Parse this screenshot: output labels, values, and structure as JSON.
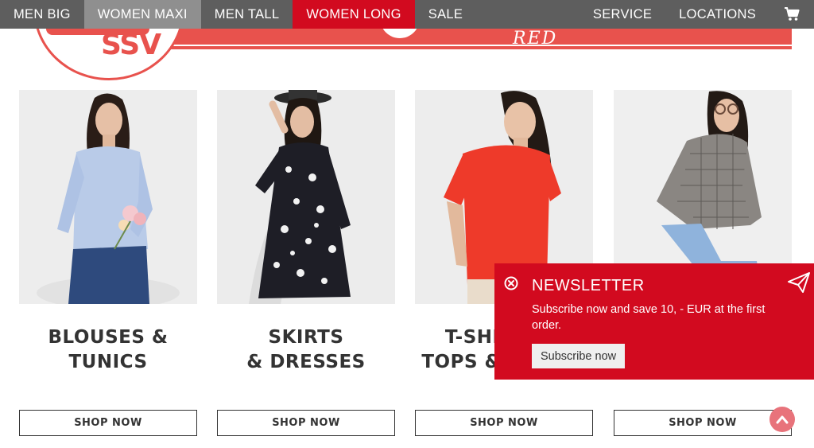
{
  "nav": {
    "items": [
      {
        "label": "MEN BIG"
      },
      {
        "label": "WOMEN MAXI"
      },
      {
        "label": "MEN TALL"
      },
      {
        "label": "WOMEN LONG"
      },
      {
        "label": "SALE"
      }
    ],
    "service": "SERVICE",
    "locations": "LOCATIONS",
    "cart_icon": "shopping-cart-icon"
  },
  "banner": {
    "logo_text": "SSV",
    "cursive_text": "RED"
  },
  "products": [
    {
      "title_line1": "BLOUSES &",
      "title_line2": "TUNICS",
      "button": "SHOP NOW",
      "garment_color": "#b9cbe8"
    },
    {
      "title_line1": "SKIRTS",
      "title_line2": "& DRESSES",
      "button": "SHOP NOW",
      "garment_color": "#1e1e26"
    },
    {
      "title_line1": "T-SHIRTS &",
      "title_line2": "TOPS & TUNICS",
      "button": "SHOP NOW",
      "garment_color": "#ee3a2a"
    },
    {
      "title_line1": "",
      "title_line2": "",
      "button": "SHOP NOW",
      "garment_color": "#8a8682"
    }
  ],
  "newsletter": {
    "title": "NEWSLETTER",
    "text": "Subscribe now and save 10, - EUR at the first order.",
    "button": "Subscribe now",
    "close_icon": "close-icon",
    "send_icon": "paper-plane-icon"
  },
  "scroll_top_icon": "chevron-up-icon",
  "colors": {
    "nav_bg": "#5e5e5e",
    "nav_highlight": "#8f8f8f",
    "brand_red": "#d20a1f",
    "banner_red": "#e8524d"
  }
}
